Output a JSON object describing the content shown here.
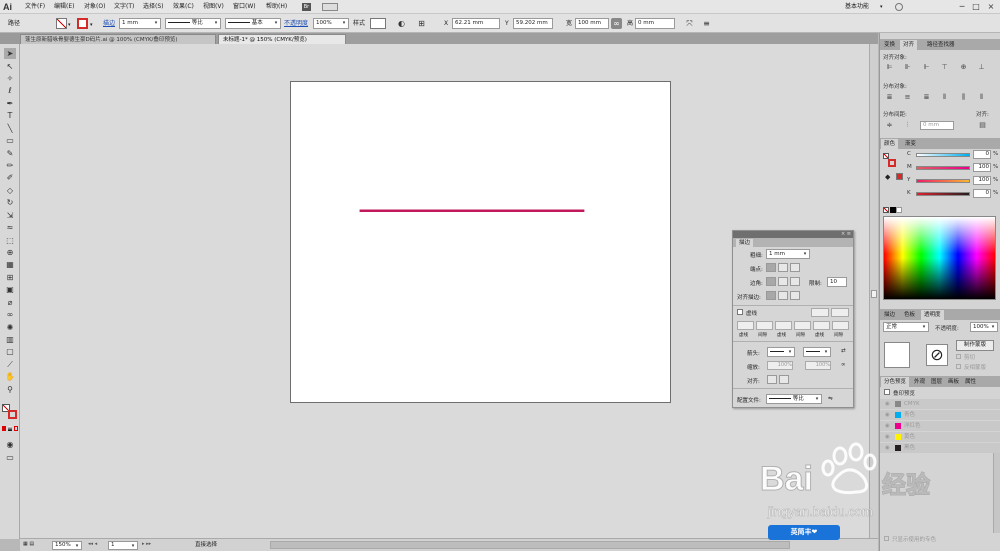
{
  "app": {
    "logo": "Ai"
  },
  "menu": {
    "items": [
      "文件(F)",
      "编辑(E)",
      "对象(O)",
      "文字(T)",
      "选择(S)",
      "效果(C)",
      "视图(V)",
      "窗口(W)",
      "帮助(H)"
    ],
    "workspace": "基本功能",
    "win_minimize": "─",
    "win_maximize": "□",
    "win_close": "×"
  },
  "control": {
    "object_type": "路径",
    "stroke_label": "描边",
    "stroke_weight": "1 mm",
    "profile_label": "等比",
    "brush_label": "基本",
    "opacity_label": "不透明度",
    "opacity_value": "100%",
    "style_label": "样式",
    "x_label": "X",
    "x_value": "62.21 mm",
    "y_label": "Y",
    "y_value": "59.202 mm",
    "w_label": "宽",
    "w_value": "100 mm",
    "h_label": "高",
    "h_value": "0 mm"
  },
  "tabs": [
    {
      "label": "蓬生原新腊咏骨婴德生豪D码片.ai @ 100% (CMYK/叠印预览)",
      "active": false
    },
    {
      "label": "未标题-1* @ 150% (CMYK/预览)",
      "active": true
    }
  ],
  "tools": [
    "selection",
    "direct-selection",
    "magic-wand",
    "lasso",
    "pen",
    "type",
    "line",
    "rectangle",
    "paintbrush",
    "pencil",
    "blob-brush",
    "eraser",
    "rotate",
    "scale",
    "width",
    "free-transform",
    "shape-builder",
    "perspective",
    "mesh",
    "gradient",
    "eyedropper",
    "blend",
    "symbol-sprayer",
    "column-graph",
    "artboard",
    "slice",
    "hand",
    "zoom"
  ],
  "artwork": {
    "line_color": "#c2185b",
    "line_start": [
      0.18,
      0.4
    ],
    "line_end": [
      0.77,
      0.4
    ]
  },
  "status": {
    "zoom": "150%",
    "artboard_num": "1",
    "tool_name": "直接选择"
  },
  "align_panel": {
    "tabs": [
      "变换",
      "对齐",
      "路径查找器"
    ],
    "align_objects": "对齐对象:",
    "distribute_objects": "分布对象:",
    "distribute_spacing": "分布间距:",
    "spacing_value": "0 mm",
    "align_to": "对齐:"
  },
  "color_panel": {
    "tabs": [
      "颜色",
      "渐变"
    ],
    "channels": [
      {
        "label": "C",
        "value": "0",
        "color": "#00aeef"
      },
      {
        "label": "M",
        "value": "100",
        "color": "#ec008c"
      },
      {
        "label": "Y",
        "value": "100",
        "color": "#fff200"
      },
      {
        "label": "K",
        "value": "0",
        "color": "#231f20"
      }
    ],
    "unit": "%"
  },
  "transparency_panel": {
    "tabs": [
      "描边",
      "色板",
      "透明度"
    ],
    "blend_mode": "正常",
    "opacity_label": "不透明度:",
    "opacity_value": "100%",
    "make_mask": "制作蒙版",
    "clip": "剪切",
    "invert_mask": "反相蒙版"
  },
  "separations_panel": {
    "tabs": [
      "分色预览",
      "外观",
      "图层",
      "画板",
      "属性"
    ],
    "overprint_preview": "叠印预览",
    "rows": [
      {
        "label": "CMYK",
        "color": "#888888"
      },
      {
        "label": "青色",
        "color": "#00aeef"
      },
      {
        "label": "洋红色",
        "color": "#ec008c"
      },
      {
        "label": "黄色",
        "color": "#fff200"
      },
      {
        "label": "黑色",
        "color": "#231f20"
      }
    ],
    "footer": "只显示使用的专色"
  },
  "stroke_panel": {
    "title": "描边",
    "weight_label": "粗细:",
    "weight_value": "1 mm",
    "cap_label": "端点:",
    "corner_label": "边角:",
    "limit_label": "限制:",
    "limit_value": "10",
    "align_label": "对齐描边:",
    "dashed_label": "虚线",
    "dash_labels": [
      "虚线",
      "间隙",
      "虚线",
      "间隙",
      "虚线",
      "间隙"
    ],
    "arrow_label": "箭头:",
    "scale_value_1": "100%",
    "scale_value_2": "100%",
    "profile_label": "配置文件:",
    "profile_value": "等比"
  },
  "watermark": {
    "brand": "Bai",
    "brand2": "经验",
    "url": "jingyan.baidu.com",
    "badge": "英简丰❤"
  }
}
